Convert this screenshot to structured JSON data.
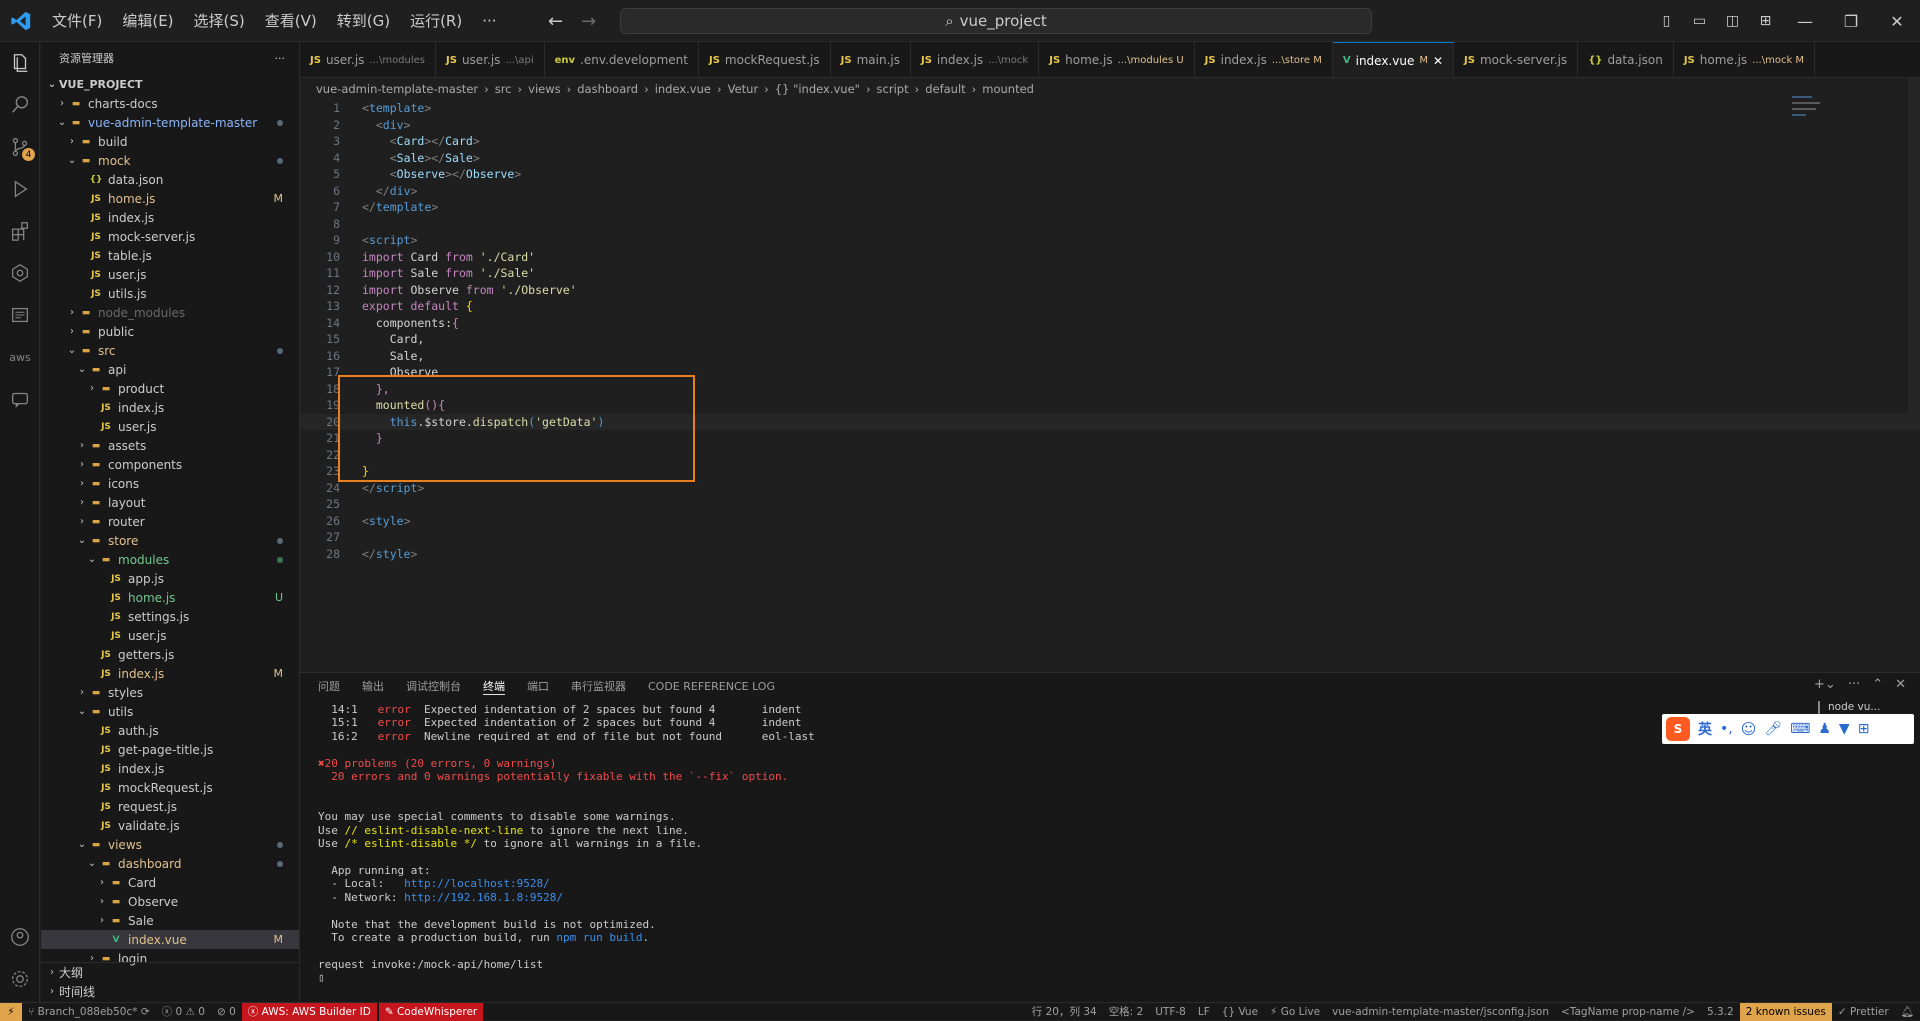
{
  "titlebar": {
    "menus": [
      "文件(F)",
      "编辑(E)",
      "选择(S)",
      "查看(V)",
      "转到(G)",
      "运行(R)",
      "···"
    ],
    "search": "vue_project"
  },
  "sidebar": {
    "title": "资源管理器",
    "root": "VUE_PROJECT",
    "items": [
      {
        "label": "charts-docs",
        "depth": 1,
        "kind": "folder",
        "open": false,
        "status": ""
      },
      {
        "label": "vue-admin-template-master",
        "depth": 1,
        "kind": "folder",
        "open": true,
        "status": "dot"
      },
      {
        "label": "build",
        "depth": 2,
        "kind": "folder",
        "open": false,
        "status": ""
      },
      {
        "label": "mock",
        "depth": 2,
        "kind": "folder",
        "open": true,
        "status": "dot"
      },
      {
        "label": "data.json",
        "depth": 3,
        "kind": "json",
        "status": ""
      },
      {
        "label": "home.js",
        "depth": 3,
        "kind": "js",
        "status": "M"
      },
      {
        "label": "index.js",
        "depth": 3,
        "kind": "js",
        "status": ""
      },
      {
        "label": "mock-server.js",
        "depth": 3,
        "kind": "js",
        "status": ""
      },
      {
        "label": "table.js",
        "depth": 3,
        "kind": "js",
        "status": ""
      },
      {
        "label": "user.js",
        "depth": 3,
        "kind": "js",
        "status": ""
      },
      {
        "label": "utils.js",
        "depth": 3,
        "kind": "js",
        "status": ""
      },
      {
        "label": "node_modules",
        "depth": 2,
        "kind": "folder",
        "open": false,
        "status": ""
      },
      {
        "label": "public",
        "depth": 2,
        "kind": "folder",
        "open": false,
        "status": ""
      },
      {
        "label": "src",
        "depth": 2,
        "kind": "folder",
        "open": true,
        "status": "dot"
      },
      {
        "label": "api",
        "depth": 3,
        "kind": "folder",
        "open": true,
        "status": ""
      },
      {
        "label": "product",
        "depth": 4,
        "kind": "folder",
        "open": false,
        "status": ""
      },
      {
        "label": "index.js",
        "depth": 4,
        "kind": "js",
        "status": ""
      },
      {
        "label": "user.js",
        "depth": 4,
        "kind": "js",
        "status": ""
      },
      {
        "label": "assets",
        "depth": 3,
        "kind": "folder",
        "open": false,
        "status": ""
      },
      {
        "label": "components",
        "depth": 3,
        "kind": "folder",
        "open": false,
        "status": ""
      },
      {
        "label": "icons",
        "depth": 3,
        "kind": "folder",
        "open": false,
        "status": ""
      },
      {
        "label": "layout",
        "depth": 3,
        "kind": "folder",
        "open": false,
        "status": ""
      },
      {
        "label": "router",
        "depth": 3,
        "kind": "folder",
        "open": false,
        "status": ""
      },
      {
        "label": "store",
        "depth": 3,
        "kind": "folder",
        "open": true,
        "status": "dot"
      },
      {
        "label": "modules",
        "depth": 4,
        "kind": "folder",
        "open": true,
        "status": "dotg"
      },
      {
        "label": "app.js",
        "depth": 5,
        "kind": "js",
        "status": ""
      },
      {
        "label": "home.js",
        "depth": 5,
        "kind": "js",
        "status": "U"
      },
      {
        "label": "settings.js",
        "depth": 5,
        "kind": "js",
        "status": ""
      },
      {
        "label": "user.js",
        "depth": 5,
        "kind": "js",
        "status": ""
      },
      {
        "label": "getters.js",
        "depth": 4,
        "kind": "js",
        "status": ""
      },
      {
        "label": "index.js",
        "depth": 4,
        "kind": "js",
        "status": "M"
      },
      {
        "label": "styles",
        "depth": 3,
        "kind": "folder",
        "open": false,
        "status": ""
      },
      {
        "label": "utils",
        "depth": 3,
        "kind": "folder",
        "open": true,
        "status": ""
      },
      {
        "label": "auth.js",
        "depth": 4,
        "kind": "js",
        "status": ""
      },
      {
        "label": "get-page-title.js",
        "depth": 4,
        "kind": "js",
        "status": ""
      },
      {
        "label": "index.js",
        "depth": 4,
        "kind": "js",
        "status": ""
      },
      {
        "label": "mockRequest.js",
        "depth": 4,
        "kind": "js",
        "status": ""
      },
      {
        "label": "request.js",
        "depth": 4,
        "kind": "js",
        "status": ""
      },
      {
        "label": "validate.js",
        "depth": 4,
        "kind": "js",
        "status": ""
      },
      {
        "label": "views",
        "depth": 3,
        "kind": "folder",
        "open": true,
        "status": "dot"
      },
      {
        "label": "dashboard",
        "depth": 4,
        "kind": "folder",
        "open": true,
        "status": "dot"
      },
      {
        "label": "Card",
        "depth": 5,
        "kind": "folder",
        "open": false,
        "status": ""
      },
      {
        "label": "Observe",
        "depth": 5,
        "kind": "folder",
        "open": false,
        "status": ""
      },
      {
        "label": "Sale",
        "depth": 5,
        "kind": "folder",
        "open": false,
        "status": ""
      },
      {
        "label": "index.vue",
        "depth": 5,
        "kind": "vue",
        "status": "M",
        "selected": true
      },
      {
        "label": "login",
        "depth": 4,
        "kind": "folder",
        "open": false,
        "status": ""
      }
    ],
    "outline": "大纲",
    "timeline": "时间线"
  },
  "tabs": [
    {
      "name": "user.js",
      "sub": "...\\modules",
      "icon": "JS"
    },
    {
      "name": "user.js",
      "sub": "...\\api",
      "icon": "JS"
    },
    {
      "name": ".env.development",
      "sub": "",
      "icon": "env"
    },
    {
      "name": "mockRequest.js",
      "sub": "",
      "icon": "JS"
    },
    {
      "name": "main.js",
      "sub": "",
      "icon": "JS"
    },
    {
      "name": "index.js",
      "sub": "...\\mock",
      "icon": "JS"
    },
    {
      "name": "home.js",
      "sub": "...\\modules U",
      "icon": "JS"
    },
    {
      "name": "index.js",
      "sub": "...\\store M",
      "icon": "JS"
    },
    {
      "name": "index.vue",
      "sub": "M",
      "icon": "V",
      "active": true
    },
    {
      "name": "mock-server.js",
      "sub": "",
      "icon": "JS"
    },
    {
      "name": "data.json",
      "sub": "",
      "icon": "{}"
    },
    {
      "name": "home.js",
      "sub": "...\\mock M",
      "icon": "JS"
    }
  ],
  "breadcrumb": [
    "vue-admin-template-master",
    "src",
    "views",
    "dashboard",
    "index.vue",
    "Vetur",
    "{} \"index.vue\"",
    "script",
    "default",
    "mounted"
  ],
  "code": [
    [
      [
        "t",
        "<"
      ],
      [
        "g",
        "template"
      ],
      [
        "t",
        ">"
      ]
    ],
    [
      [
        "w",
        "  "
      ],
      [
        "t",
        "<"
      ],
      [
        "g",
        "div"
      ],
      [
        "t",
        ">"
      ]
    ],
    [
      [
        "w",
        "    "
      ],
      [
        "t",
        "<"
      ],
      [
        "b",
        "Card"
      ],
      [
        "t",
        "></"
      ],
      [
        "b",
        "Card"
      ],
      [
        "t",
        ">"
      ]
    ],
    [
      [
        "w",
        "    "
      ],
      [
        "t",
        "<"
      ],
      [
        "b",
        "Sale"
      ],
      [
        "t",
        "></"
      ],
      [
        "b",
        "Sale"
      ],
      [
        "t",
        ">"
      ]
    ],
    [
      [
        "w",
        "    "
      ],
      [
        "t",
        "<"
      ],
      [
        "b",
        "Observe"
      ],
      [
        "t",
        "></"
      ],
      [
        "b",
        "Observe"
      ],
      [
        "t",
        ">"
      ]
    ],
    [
      [
        "w",
        "  "
      ],
      [
        "t",
        "</"
      ],
      [
        "g",
        "div"
      ],
      [
        "t",
        ">"
      ]
    ],
    [
      [
        "t",
        "</"
      ],
      [
        "g",
        "template"
      ],
      [
        "t",
        ">"
      ]
    ],
    [],
    [
      [
        "t",
        "<"
      ],
      [
        "g",
        "script"
      ],
      [
        "t",
        ">"
      ]
    ],
    [
      [
        "k",
        "import "
      ],
      [
        "w",
        "Card "
      ],
      [
        "k",
        "from "
      ],
      [
        "y",
        "'./Card'"
      ]
    ],
    [
      [
        "k",
        "import "
      ],
      [
        "w",
        "Sale "
      ],
      [
        "k",
        "from "
      ],
      [
        "y",
        "'./Sale'"
      ]
    ],
    [
      [
        "k",
        "import "
      ],
      [
        "w",
        "Observe "
      ],
      [
        "k",
        "from "
      ],
      [
        "y",
        "'./Observe'"
      ]
    ],
    [
      [
        "k",
        "export default "
      ],
      [
        "o",
        "{"
      ]
    ],
    [
      [
        "w",
        "  components:"
      ],
      [
        "k",
        "{"
      ]
    ],
    [
      [
        "w",
        "    Card,"
      ]
    ],
    [
      [
        "w",
        "    Sale,"
      ]
    ],
    [
      [
        "w",
        "    Observe"
      ]
    ],
    [
      [
        "w",
        "  "
      ],
      [
        "k",
        "},"
      ]
    ],
    [
      [
        "w",
        "  "
      ],
      [
        "y",
        "mounted"
      ],
      [
        "k",
        "(){"
      ]
    ],
    [
      [
        "w",
        "    "
      ],
      [
        "g",
        "this"
      ],
      [
        "w",
        ".$store."
      ],
      [
        "y",
        "dispatch"
      ],
      [
        "g",
        "("
      ],
      [
        "y",
        "'getData'"
      ],
      [
        "g",
        ")"
      ]
    ],
    [
      [
        "w",
        "  "
      ],
      [
        "k",
        "}"
      ]
    ],
    [],
    [
      [
        "o",
        "}"
      ]
    ],
    [
      [
        "t",
        "</"
      ],
      [
        "g",
        "script"
      ],
      [
        "t",
        ">"
      ]
    ],
    [],
    [
      [
        "t",
        "<"
      ],
      [
        "g",
        "style"
      ],
      [
        "t",
        ">"
      ]
    ],
    [],
    [
      [
        "t",
        "</"
      ],
      [
        "g",
        "style"
      ],
      [
        "t",
        ">"
      ]
    ]
  ],
  "panel": {
    "tabs": [
      "问题",
      "输出",
      "调试控制台",
      "终端",
      "端口",
      "串行监视器",
      "CODE REFERENCE LOG"
    ],
    "active": "终端",
    "node": "node vu...",
    "lines": [
      [
        [
          "w",
          "  14:1   "
        ],
        [
          "red",
          "error"
        ],
        [
          "w",
          "  Expected indentation of 2 spaces but found 4       indent"
        ]
      ],
      [
        [
          "w",
          "  15:1   "
        ],
        [
          "red",
          "error"
        ],
        [
          "w",
          "  Expected indentation of 2 spaces but found 4       indent"
        ]
      ],
      [
        [
          "w",
          "  16:2   "
        ],
        [
          "red",
          "error"
        ],
        [
          "w",
          "  Newline required at end of file but not found      eol-last"
        ]
      ],
      [],
      [
        [
          "red",
          "✖20 problems (20 errors, 0 warnings)"
        ]
      ],
      [
        [
          "red",
          "  20 errors and 0 warnings potentially fixable with the `--fix` option."
        ]
      ],
      [],
      [],
      [
        [
          "w",
          "You may use special comments to disable some warnings."
        ]
      ],
      [
        [
          "w",
          "Use "
        ],
        [
          "yl",
          "// eslint-disable-next-line"
        ],
        [
          "w",
          " to ignore the next line."
        ]
      ],
      [
        [
          "w",
          "Use "
        ],
        [
          "yl",
          "/* eslint-disable */"
        ],
        [
          "w",
          " to ignore all warnings in a file."
        ]
      ],
      [],
      [
        [
          "w",
          "  App running at:"
        ]
      ],
      [
        [
          "w",
          "  - Local:   "
        ],
        [
          "cy",
          "http://localhost:9528/"
        ]
      ],
      [
        [
          "w",
          "  - Network: "
        ],
        [
          "cy",
          "http://192.168.1.8:9528/"
        ]
      ],
      [],
      [
        [
          "w",
          "  Note that the development build is not optimized."
        ]
      ],
      [
        [
          "w",
          "  To create a production build, run "
        ],
        [
          "cy",
          "npm run build"
        ],
        [
          "w",
          "."
        ]
      ],
      [],
      [
        [
          "w",
          "request invoke:/mock-api/home/list"
        ]
      ],
      [
        [
          "w",
          "▯"
        ]
      ]
    ]
  },
  "statusbar": {
    "branch": "Branch_088eb50c*",
    "errors": "0",
    "warnings": "0",
    "ports": "0",
    "aws": "AWS: AWS Builder ID",
    "cw": "CodeWhisperer",
    "right": [
      "行 20，列 34",
      "空格: 2",
      "UTF-8",
      "LF",
      "{} Vue",
      "⚡ Go Live",
      "vue-admin-template-master/jsconfig.json",
      "<TagName prop-name />",
      "5.3.2"
    ],
    "issues": "2 known issues",
    "prettier": "✓ Prettier"
  }
}
